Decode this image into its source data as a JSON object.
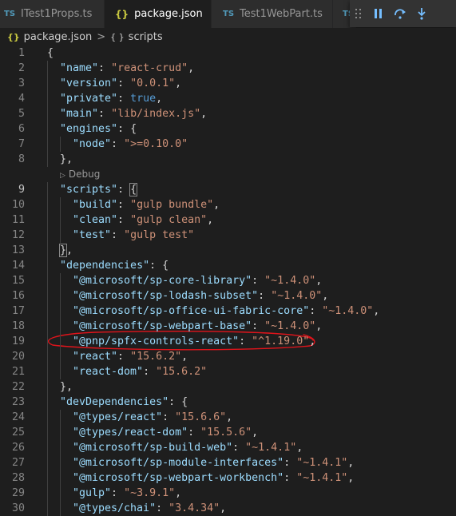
{
  "tabs": [
    {
      "label": "ITest1Props.ts",
      "icon": "TS",
      "active": false
    },
    {
      "label": "package.json",
      "icon": "{}",
      "active": true,
      "close": "×"
    },
    {
      "label": "Test1WebPart.ts",
      "icon": "TS",
      "active": false
    },
    {
      "label": "",
      "icon": "TS",
      "active": false
    }
  ],
  "breadcrumb": {
    "file": "package.json",
    "separator": ">",
    "node": "scripts"
  },
  "codelens": {
    "label": "Debug"
  },
  "lines": [
    {
      "n": "1",
      "tokens": [
        [
          "p",
          "{"
        ]
      ]
    },
    {
      "n": "2",
      "tokens": [
        [
          "k",
          "\"name\""
        ],
        [
          "p",
          ": "
        ],
        [
          "s",
          "\"react-crud\""
        ],
        [
          "p",
          ","
        ]
      ]
    },
    {
      "n": "3",
      "tokens": [
        [
          "k",
          "\"version\""
        ],
        [
          "p",
          ": "
        ],
        [
          "s",
          "\"0.0.1\""
        ],
        [
          "p",
          ","
        ]
      ]
    },
    {
      "n": "4",
      "tokens": [
        [
          "k",
          "\"private\""
        ],
        [
          "p",
          ": "
        ],
        [
          "b",
          "true"
        ],
        [
          "p",
          ","
        ]
      ]
    },
    {
      "n": "5",
      "tokens": [
        [
          "k",
          "\"main\""
        ],
        [
          "p",
          ": "
        ],
        [
          "s",
          "\"lib/index.js\""
        ],
        [
          "p",
          ","
        ]
      ]
    },
    {
      "n": "6",
      "tokens": [
        [
          "k",
          "\"engines\""
        ],
        [
          "p",
          ": {"
        ]
      ]
    },
    {
      "n": "7",
      "tokens": [
        [
          "k",
          "\"node\""
        ],
        [
          "p",
          ": "
        ],
        [
          "s",
          "\">=0.10.0\""
        ]
      ]
    },
    {
      "n": "8",
      "tokens": [
        [
          "p",
          "},"
        ]
      ]
    },
    {
      "n": "9",
      "tokens": [
        [
          "k",
          "\"scripts\""
        ],
        [
          "p",
          ": "
        ],
        [
          "p",
          "{"
        ]
      ]
    },
    {
      "n": "10",
      "tokens": [
        [
          "k",
          "\"build\""
        ],
        [
          "p",
          ": "
        ],
        [
          "s",
          "\"gulp bundle\""
        ],
        [
          "p",
          ","
        ]
      ]
    },
    {
      "n": "11",
      "tokens": [
        [
          "k",
          "\"clean\""
        ],
        [
          "p",
          ": "
        ],
        [
          "s",
          "\"gulp clean\""
        ],
        [
          "p",
          ","
        ]
      ]
    },
    {
      "n": "12",
      "tokens": [
        [
          "k",
          "\"test\""
        ],
        [
          "p",
          ": "
        ],
        [
          "s",
          "\"gulp test\""
        ]
      ]
    },
    {
      "n": "13",
      "tokens": [
        [
          "p",
          "}"
        ],
        [
          "p",
          ","
        ]
      ]
    },
    {
      "n": "14",
      "tokens": [
        [
          "k",
          "\"dependencies\""
        ],
        [
          "p",
          ": {"
        ]
      ]
    },
    {
      "n": "15",
      "tokens": [
        [
          "k",
          "\"@microsoft/sp-core-library\""
        ],
        [
          "p",
          ": "
        ],
        [
          "s",
          "\"~1.4.0\""
        ],
        [
          "p",
          ","
        ]
      ]
    },
    {
      "n": "16",
      "tokens": [
        [
          "k",
          "\"@microsoft/sp-lodash-subset\""
        ],
        [
          "p",
          ": "
        ],
        [
          "s",
          "\"~1.4.0\""
        ],
        [
          "p",
          ","
        ]
      ]
    },
    {
      "n": "17",
      "tokens": [
        [
          "k",
          "\"@microsoft/sp-office-ui-fabric-core\""
        ],
        [
          "p",
          ": "
        ],
        [
          "s",
          "\"~1.4.0\""
        ],
        [
          "p",
          ","
        ]
      ]
    },
    {
      "n": "18",
      "tokens": [
        [
          "k",
          "\"@microsoft/sp-webpart-base\""
        ],
        [
          "p",
          ": "
        ],
        [
          "s",
          "\"~1.4.0\""
        ],
        [
          "p",
          ","
        ]
      ]
    },
    {
      "n": "19",
      "tokens": [
        [
          "k",
          "\"@pnp/spfx-controls-react\""
        ],
        [
          "p",
          ": "
        ],
        [
          "s",
          "\"^1.19.0\""
        ],
        [
          "p",
          ","
        ]
      ]
    },
    {
      "n": "20",
      "tokens": [
        [
          "k",
          "\"react\""
        ],
        [
          "p",
          ": "
        ],
        [
          "s",
          "\"15.6.2\""
        ],
        [
          "p",
          ","
        ]
      ]
    },
    {
      "n": "21",
      "tokens": [
        [
          "k",
          "\"react-dom\""
        ],
        [
          "p",
          ": "
        ],
        [
          "s",
          "\"15.6.2\""
        ]
      ]
    },
    {
      "n": "22",
      "tokens": [
        [
          "p",
          "},"
        ]
      ]
    },
    {
      "n": "23",
      "tokens": [
        [
          "k",
          "\"devDependencies\""
        ],
        [
          "p",
          ": {"
        ]
      ]
    },
    {
      "n": "24",
      "tokens": [
        [
          "k",
          "\"@types/react\""
        ],
        [
          "p",
          ": "
        ],
        [
          "s",
          "\"15.6.6\""
        ],
        [
          "p",
          ","
        ]
      ]
    },
    {
      "n": "25",
      "tokens": [
        [
          "k",
          "\"@types/react-dom\""
        ],
        [
          "p",
          ": "
        ],
        [
          "s",
          "\"15.5.6\""
        ],
        [
          "p",
          ","
        ]
      ]
    },
    {
      "n": "26",
      "tokens": [
        [
          "k",
          "\"@microsoft/sp-build-web\""
        ],
        [
          "p",
          ": "
        ],
        [
          "s",
          "\"~1.4.1\""
        ],
        [
          "p",
          ","
        ]
      ]
    },
    {
      "n": "27",
      "tokens": [
        [
          "k",
          "\"@microsoft/sp-module-interfaces\""
        ],
        [
          "p",
          ": "
        ],
        [
          "s",
          "\"~1.4.1\""
        ],
        [
          "p",
          ","
        ]
      ]
    },
    {
      "n": "28",
      "tokens": [
        [
          "k",
          "\"@microsoft/sp-webpart-workbench\""
        ],
        [
          "p",
          ": "
        ],
        [
          "s",
          "\"~1.4.1\""
        ],
        [
          "p",
          ","
        ]
      ]
    },
    {
      "n": "29",
      "tokens": [
        [
          "k",
          "\"gulp\""
        ],
        [
          "p",
          ": "
        ],
        [
          "s",
          "\"~3.9.1\""
        ],
        [
          "p",
          ","
        ]
      ]
    },
    {
      "n": "30",
      "tokens": [
        [
          "k",
          "\"@types/chai\""
        ],
        [
          "p",
          ": "
        ],
        [
          "s",
          "\"3.4.34\""
        ],
        [
          "p",
          ","
        ]
      ]
    }
  ],
  "colors": {
    "key": "#9cdcfe",
    "string": "#ce9178",
    "boolean": "#569cd6",
    "punctuation": "#d4d4d4",
    "annotation": "#e0141b"
  },
  "debug_toolbar": [
    "gripper-icon",
    "pause-icon",
    "step-over-icon",
    "step-into-icon"
  ]
}
